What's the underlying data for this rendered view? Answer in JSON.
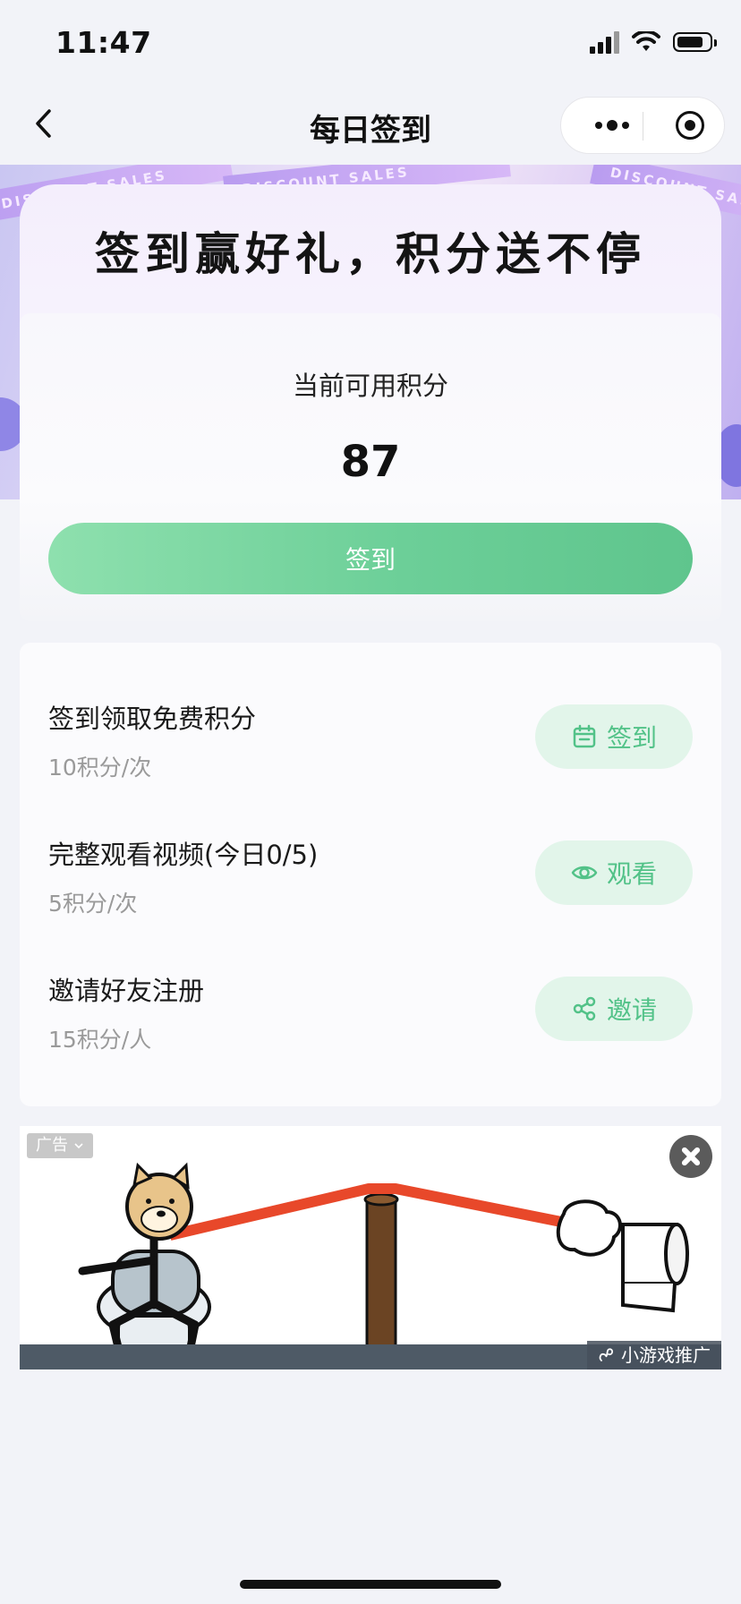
{
  "status_bar": {
    "time": "11:47"
  },
  "nav": {
    "title": "每日签到"
  },
  "banner": {
    "slogan": "签到赢好礼，积分送不停",
    "stripe_text": "DISCOUNT SALES"
  },
  "points": {
    "label": "当前可用积分",
    "value": "87",
    "button_label": "签到"
  },
  "tasks": [
    {
      "title": "签到领取免费积分",
      "reward": "10积分/次",
      "button_label": "签到",
      "icon": "calendar-icon"
    },
    {
      "title": "完整观看视频(今日0/5)",
      "reward": "5积分/次",
      "button_label": "观看",
      "icon": "eye-icon"
    },
    {
      "title": "邀请好友注册",
      "reward": "15积分/人",
      "button_label": "邀请",
      "icon": "share-icon"
    }
  ],
  "ad": {
    "tag": "广告",
    "promo": "小游戏推广"
  },
  "colors": {
    "accent_green": "#5fc58d",
    "button_bg": "#e2f5ea",
    "page_bg": "#f2f3f8"
  }
}
